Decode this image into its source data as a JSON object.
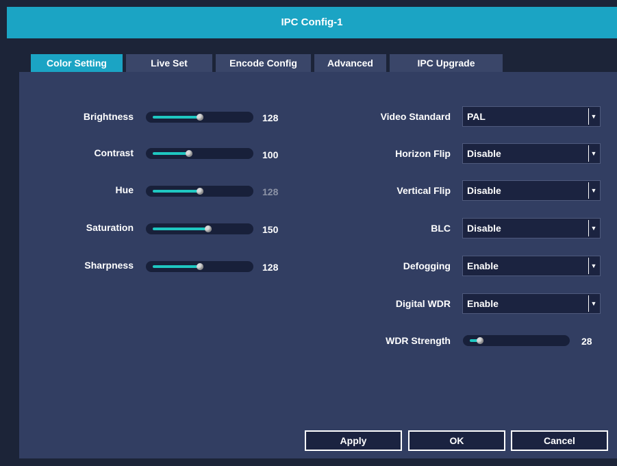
{
  "window": {
    "title": "IPC Config-1"
  },
  "tabs": [
    {
      "label": "Color Setting",
      "active": true
    },
    {
      "label": "Live Set",
      "active": false
    },
    {
      "label": "Encode Config",
      "active": false
    },
    {
      "label": "Advanced",
      "active": false
    },
    {
      "label": "IPC Upgrade",
      "active": false
    }
  ],
  "sliders": [
    {
      "label": "Brightness",
      "value": "128",
      "level": 0.5
    },
    {
      "label": "Contrast",
      "value": "100",
      "level": 0.39
    },
    {
      "label": "Hue",
      "value": "128",
      "level": 0.5
    },
    {
      "label": "Saturation",
      "value": "150",
      "level": 0.59
    },
    {
      "label": "Sharpness",
      "value": "128",
      "level": 0.5
    }
  ],
  "selects": [
    {
      "label": "Video Standard",
      "value": "PAL"
    },
    {
      "label": "Horizon Flip",
      "value": "Disable"
    },
    {
      "label": "Vertical Flip",
      "value": "Disable"
    },
    {
      "label": "BLC",
      "value": "Disable"
    },
    {
      "label": "Defogging",
      "value": "Enable"
    },
    {
      "label": "Digital WDR",
      "value": "Enable"
    }
  ],
  "wdr": {
    "label": "WDR Strength",
    "value": "28",
    "level": 0.11
  },
  "buttons": {
    "apply": "Apply",
    "ok": "OK",
    "cancel": "Cancel"
  },
  "colors": {
    "accent": "#1ba4c4",
    "slider_fill": "#1fc7c1",
    "panel": "#323e62"
  }
}
